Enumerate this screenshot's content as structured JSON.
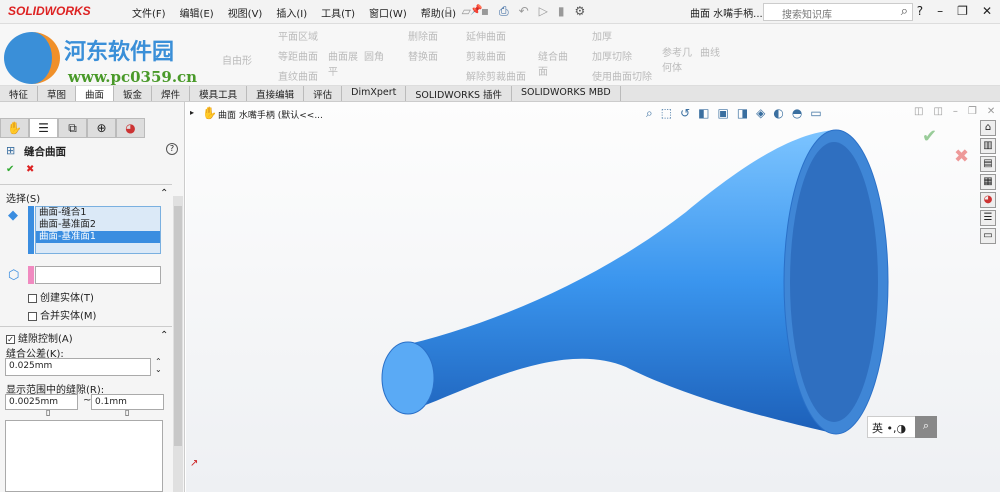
{
  "app": {
    "logo": "SOLIDWORKS",
    "document_title": "曲面 水嘴手柄..."
  },
  "menu": [
    "文件(F)",
    "编辑(E)",
    "视图(V)",
    "插入(I)",
    "工具(T)",
    "窗口(W)",
    "帮助(H)"
  ],
  "search": {
    "placeholder": "搜索知识库"
  },
  "watermark": {
    "name": "河东软件园",
    "url": "www.pc0359.cn"
  },
  "ribbon": {
    "items": [
      "自由形",
      "平面区域",
      "等距曲面",
      "直纹曲面",
      "曲面展平",
      "圆角",
      "删除面",
      "替换面",
      "延伸曲面",
      "剪裁曲面",
      "解除剪裁曲面",
      "缝合曲面",
      "加厚",
      "加厚切除",
      "使用曲面切除",
      "参考几何体",
      "曲线"
    ]
  },
  "tabs": [
    "特征",
    "草图",
    "曲面",
    "钣金",
    "焊件",
    "模具工具",
    "直接编辑",
    "评估",
    "DimXpert",
    "SOLIDWORKS 插件",
    "SOLIDWORKS MBD"
  ],
  "active_tab": "曲面",
  "panel": {
    "title": "缝合曲面",
    "help": "?",
    "ok": "✔",
    "cancel": "✖",
    "selection": {
      "label": "选择(S)",
      "items": [
        "曲面-缝合1",
        "曲面-基准面2",
        "曲面-基准面1"
      ],
      "selected_index": 2
    },
    "create_solid": {
      "label": "创建实体(T)",
      "checked": false
    },
    "merge_entities": {
      "label": "合并实体(M)",
      "checked": false
    },
    "gap_control": {
      "label": "缝隙控制(A)",
      "checked": true
    },
    "tolerance": {
      "label": "缝合公差(K):",
      "value": "0.025mm"
    },
    "gap_range": {
      "label": "显示范围中的缝隙(R):",
      "min": "0.0025mm",
      "sep": "~",
      "max": "0.1mm"
    }
  },
  "tree": {
    "label": "曲面 水嘴手柄 (默认<<..."
  },
  "ime": {
    "label": "英"
  }
}
